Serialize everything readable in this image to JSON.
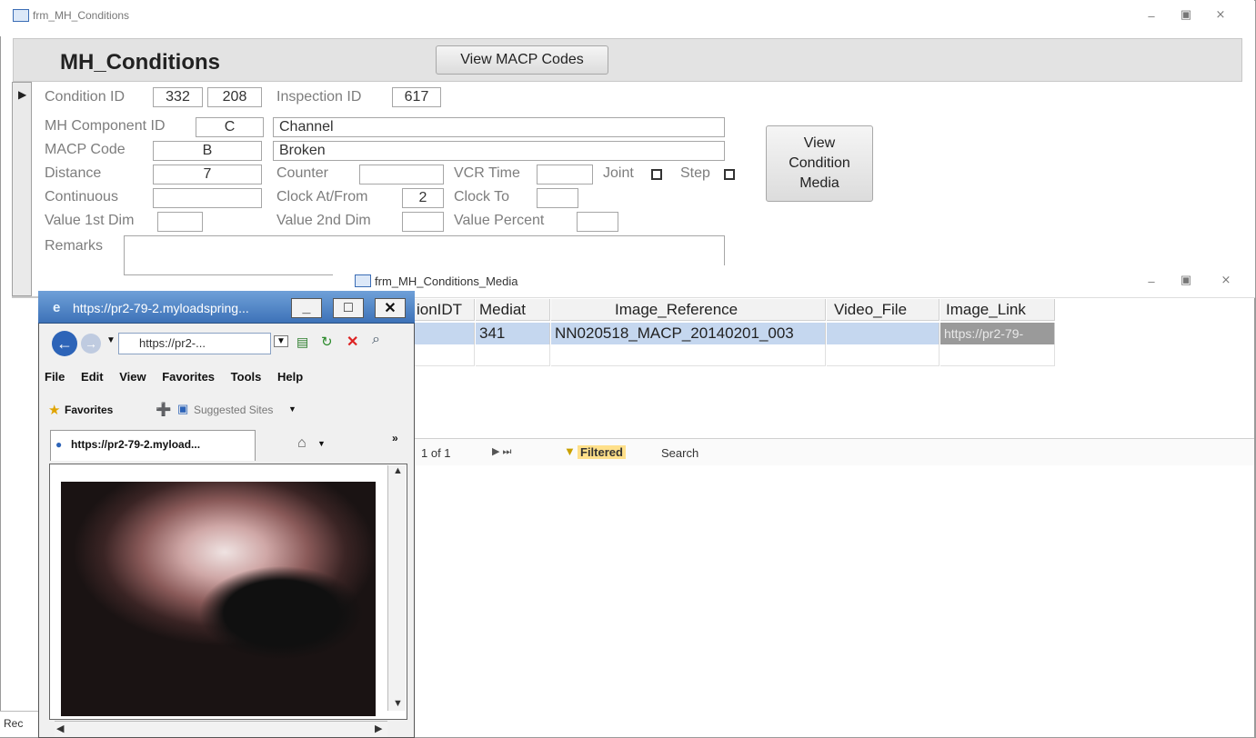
{
  "main_window": {
    "title": "frm_MH_Conditions"
  },
  "form": {
    "title": "MH_Conditions",
    "view_macp_button": "View MACP Codes",
    "view_media_button": "View Condition Media",
    "fields": {
      "condition_id_label": "Condition ID",
      "condition_id": "332",
      "condition_id_2": "208",
      "inspection_id_label": "Inspection ID",
      "inspection_id": "617",
      "mh_component_id_label": "MH Component ID",
      "mh_component_id": "C",
      "mh_component_name": "Channel",
      "macp_code_label": "MACP Code",
      "macp_code": "B",
      "macp_code_desc": "Broken",
      "distance_label": "Distance",
      "distance": "7",
      "counter_label": "Counter",
      "counter": "",
      "vcr_time_label": "VCR Time",
      "vcr_time": "",
      "joint_label": "Joint",
      "step_label": "Step",
      "continuous_label": "Continuous",
      "continuous": "",
      "clock_at_from_label": "Clock At/From",
      "clock_at_from": "2",
      "clock_to_label": "Clock To",
      "clock_to": "",
      "value_1st_dim_label": "Value 1st Dim",
      "value_1st_dim": "",
      "value_2nd_dim_label": "Value 2nd Dim",
      "value_2nd_dim": "",
      "value_percent_label": "Value Percent",
      "value_percent": "",
      "remarks_label": "Remarks",
      "remarks": ""
    },
    "record_nav_label": "Rec"
  },
  "subform": {
    "title": "frm_MH_Conditions_Media",
    "columns": [
      {
        "label": "ionIDT"
      },
      {
        "label": "Mediat"
      },
      {
        "label": "Image_Reference"
      },
      {
        "label": "Video_File"
      },
      {
        "label": "Image_Link"
      }
    ],
    "row": {
      "media_id": "341",
      "image_reference": "NN020518_MACP_20140201_003",
      "video_file": "",
      "image_link": "https://pr2-79-"
    },
    "nav": {
      "record": "1 of 1",
      "filter": "Filtered",
      "search": "Search"
    }
  },
  "browser": {
    "title": "https://pr2-79-2.myloadspring...",
    "address": "https://pr2-...",
    "menu": [
      "File",
      "Edit",
      "View",
      "Favorites",
      "Tools",
      "Help"
    ],
    "favorites_label": "Favorites",
    "suggested_sites_label": "Suggested Sites",
    "tab_label": "https://pr2-79-2.myload..."
  }
}
